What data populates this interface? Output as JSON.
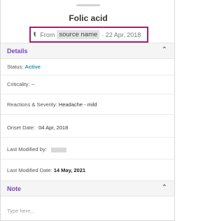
{
  "title": "Folic acid",
  "source": {
    "icon": "source-icon",
    "prefix": "From",
    "name": "source name",
    "date": "· 22 Apr, 2018"
  },
  "details": {
    "heading": "Details",
    "status_label": "Status:",
    "status_value": "Active",
    "criticality_label": "Criticality:",
    "criticality_value": "--",
    "reactions_label": "Reactions & Severity:",
    "reactions_value": "Headache - mild",
    "onset_label": "Onset Date:",
    "onset_value": "04 Apr, 2018",
    "modified_by_label": "Last Modified by:",
    "modified_date_label": "Last Modified Date:",
    "modified_date_value": "14 May, 2021"
  },
  "note": {
    "heading": "Note",
    "placeholder": "Type here..."
  },
  "colors": {
    "accent_purple": "#7b43c2",
    "highlight_border": "#a3216b",
    "status_active": "#2a8fc7"
  }
}
